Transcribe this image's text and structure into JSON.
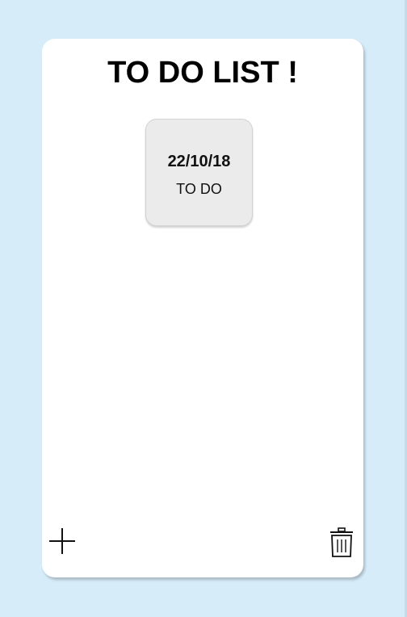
{
  "app": {
    "title": "TO DO LIST !"
  },
  "notes": [
    {
      "date": "22/10/18",
      "text": "TO DO"
    }
  ],
  "toolbar": {
    "add_icon": "plus-icon",
    "delete_icon": "trash-icon"
  },
  "colors": {
    "background": "#d6ecf9",
    "card": "#ffffff",
    "note": "#ebebeb",
    "text": "#000000"
  }
}
